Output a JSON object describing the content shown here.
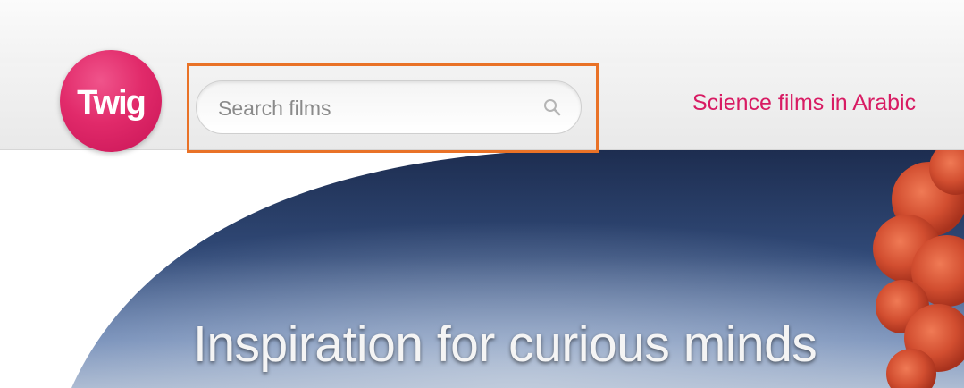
{
  "header": {
    "logo_text": "Twig",
    "search": {
      "placeholder": "Search films",
      "value": ""
    },
    "nav_link": "Science films in Arabic"
  },
  "hero": {
    "heading": "Inspiration for curious minds"
  },
  "colors": {
    "brand_pink": "#e12a6a",
    "link_pink": "#d81b63",
    "highlight_orange": "#e97227"
  },
  "icons": {
    "search": "search-icon"
  }
}
